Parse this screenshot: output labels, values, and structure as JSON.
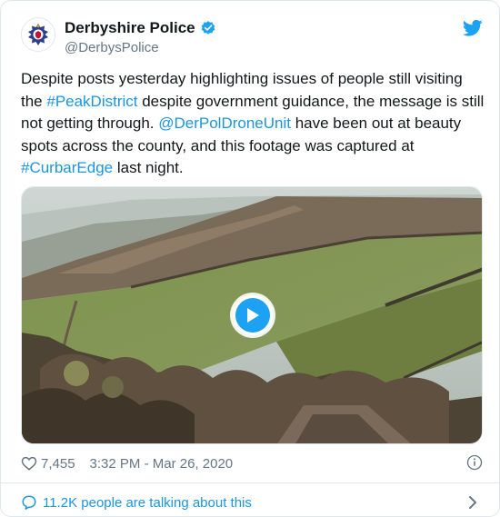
{
  "header": {
    "name": "Derbyshire Police",
    "handle": "@DerbysPolice"
  },
  "tweet": {
    "t1": "Despite posts yesterday highlighting issues of people still visiting the ",
    "hashtag1": "#PeakDistrict",
    "t2": " despite government guidance, the message is still not getting through. ",
    "mention": "@DerPolDroneUnit",
    "t3": " have been out at beauty spots across the county, and this footage was captured at ",
    "hashtag2": "#CurbarEdge",
    "t4": " last night."
  },
  "stats": {
    "likes": "7,455",
    "timestamp": "3:32 PM - Mar 26, 2020"
  },
  "footer": {
    "talking": "11.2K people are talking about this"
  },
  "colors": {
    "accent": "#1da1f2",
    "link": "#1b95e0",
    "muted": "#657786"
  },
  "icons": [
    "police-badge-icon",
    "verified-icon",
    "twitter-bird-icon",
    "play-icon",
    "heart-icon",
    "info-icon",
    "chat-bubble-icon",
    "chevron-right-icon"
  ]
}
